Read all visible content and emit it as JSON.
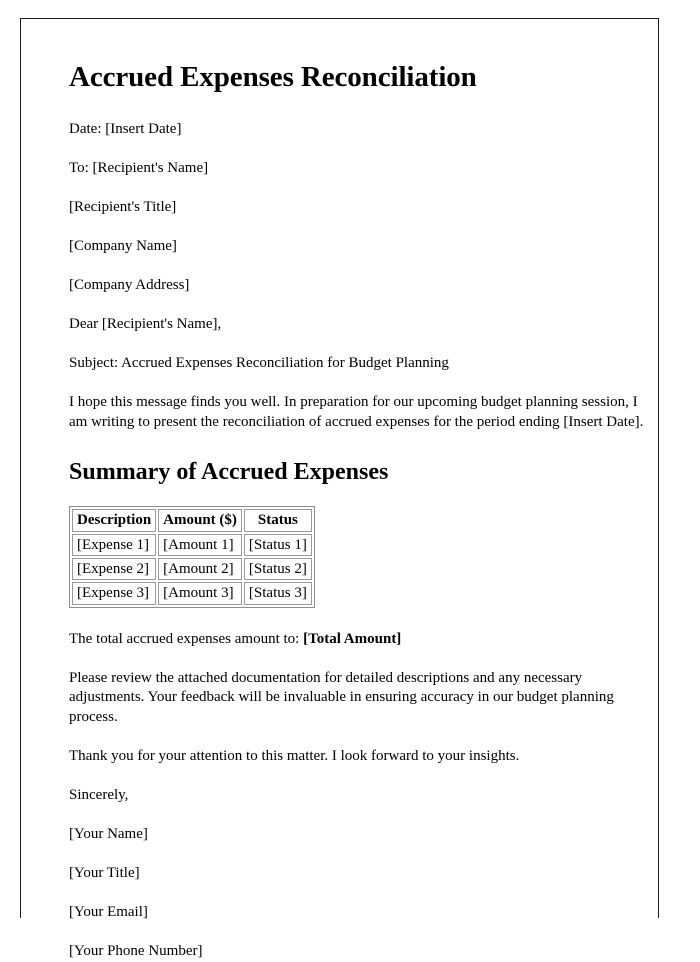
{
  "document": {
    "title": "Accrued Expenses Reconciliation",
    "header_lines": [
      "Date: [Insert Date]",
      "To: [Recipient's Name]",
      "[Recipient's Title]",
      "[Company Name]",
      "[Company Address]",
      "Dear [Recipient's Name],",
      "Subject: Accrued Expenses Reconciliation for Budget Planning"
    ],
    "intro_paragraph": "I hope this message finds you well. In preparation for our upcoming budget planning session, I am writing to present the reconciliation of accrued expenses for the period ending [Insert Date].",
    "section_heading": "Summary of Accrued Expenses",
    "table": {
      "columns": [
        "Description",
        "Amount ($)",
        "Status"
      ],
      "rows": [
        [
          "[Expense 1]",
          "[Amount 1]",
          "[Status 1]"
        ],
        [
          "[Expense 2]",
          "[Amount 2]",
          "[Status 2]"
        ],
        [
          "[Expense 3]",
          "[Amount 3]",
          "[Status 3]"
        ]
      ]
    },
    "total_line": {
      "prefix": "The total accrued expenses amount to: ",
      "value": "[Total Amount]"
    },
    "body_paragraphs": [
      "Please review the attached documentation for detailed descriptions and any necessary adjustments. Your feedback will be invaluable in ensuring accuracy in our budget planning process.",
      "Thank you for your attention to this matter. I look forward to your insights."
    ],
    "closing": "Sincerely,",
    "signature_lines": [
      "[Your Name]",
      "[Your Title]",
      "[Your Email]",
      "[Your Phone Number]"
    ]
  }
}
